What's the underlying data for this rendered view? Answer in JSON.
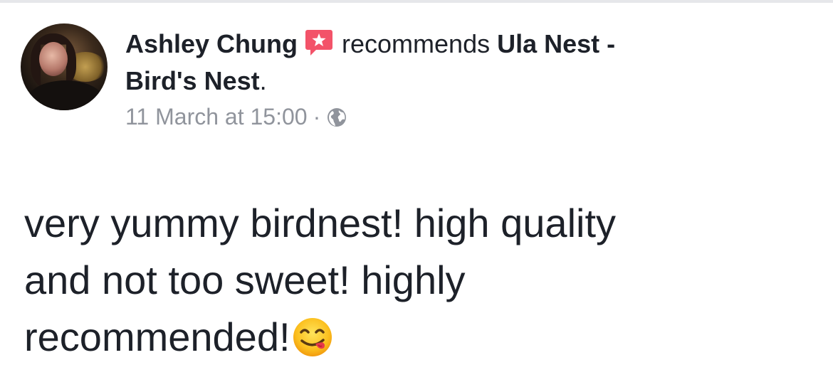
{
  "post": {
    "author_name": "Ashley Chung",
    "action_text": "recommends",
    "page_name_part1": "Ula Nest -",
    "page_name_part2": "Bird's Nest",
    "page_name_period": ".",
    "timestamp": "11 March at 15:00",
    "separator": "·",
    "privacy_icon": "globe-icon",
    "recommend_icon": "recommendation-star-icon",
    "body_line1": "very yummy birdnest! high quality",
    "body_line2": "and not too sweet! highly",
    "body_line3": "recommended!",
    "emoji": "face-savoring-food-emoji"
  },
  "colors": {
    "text": "#1d2129",
    "meta": "#90949c",
    "recommend_badge": "#f35369",
    "divider": "#e6e7ea"
  }
}
